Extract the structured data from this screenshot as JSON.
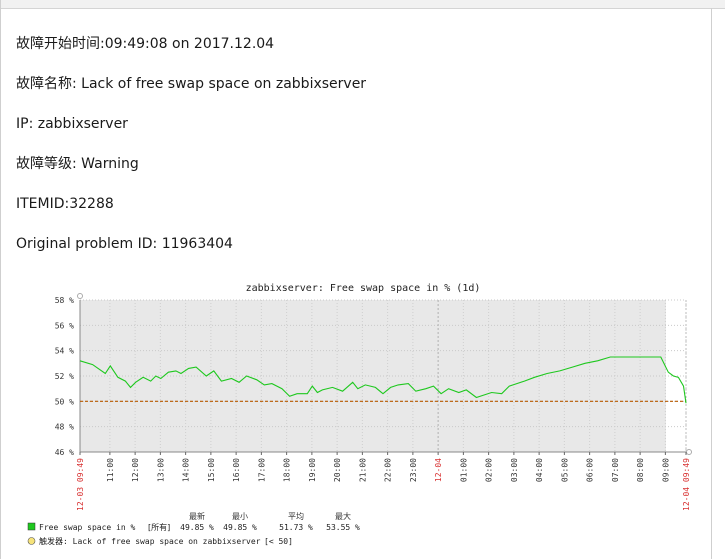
{
  "alert": {
    "start_time": "故障开始时间:09:49:08 on 2017.12.04",
    "name": "故障名称: Lack of free swap space on zabbixserver",
    "ip": "IP: zabbixserver",
    "severity": "故障等级: Warning",
    "itemid": "ITEMID:32288",
    "problem_id": "Original problem ID: 11963404"
  },
  "chart_data": {
    "type": "line",
    "title": "zabbixserver: Free swap space in % (1d)",
    "ylim": [
      46,
      58
    ],
    "y_ticks": [
      "58 %",
      "56 %",
      "54 %",
      "52 %",
      "50 %",
      "48 %",
      "46 %"
    ],
    "x_ticks": [
      "12-03 09:49",
      "11:00",
      "12:00",
      "13:00",
      "14:00",
      "15:00",
      "16:00",
      "17:00",
      "18:00",
      "19:00",
      "20:00",
      "21:00",
      "22:00",
      "23:00",
      "12-04",
      "01:00",
      "02:00",
      "03:00",
      "04:00",
      "05:00",
      "06:00",
      "07:00",
      "08:00",
      "09:00",
      "12-04 09:49"
    ],
    "red_ticks": [
      "12-03 09:49",
      "12-04",
      "12-04 09:49"
    ],
    "grid": true,
    "x": [
      0,
      0.5,
      1.0,
      1.2,
      1.5,
      1.8,
      2.0,
      2.2,
      2.5,
      2.8,
      3.0,
      3.2,
      3.5,
      3.8,
      4.0,
      4.3,
      4.6,
      5.0,
      5.3,
      5.6,
      6.0,
      6.3,
      6.6,
      7.0,
      7.3,
      7.6,
      8.0,
      8.3,
      8.6,
      9.0,
      9.2,
      9.4,
      9.6,
      10.0,
      10.4,
      10.8,
      11.0,
      11.3,
      11.7,
      12.0,
      12.3,
      12.6,
      13.0,
      13.3,
      13.7,
      14.0,
      14.3,
      14.6,
      15.0,
      15.3,
      15.7,
      16.0,
      16.3,
      16.7,
      17.0,
      17.3,
      17.6,
      18.0,
      18.5,
      19.0,
      19.5,
      20.0,
      20.5,
      21.0,
      21.5,
      22.0,
      22.5,
      23.0,
      23.3,
      23.5,
      23.7,
      23.9,
      24.0
    ],
    "series": [
      {
        "name": "Free swap space in %",
        "color": "#1ec81e",
        "values": [
          53.2,
          52.9,
          52.2,
          52.8,
          51.9,
          51.6,
          51.1,
          51.5,
          51.9,
          51.6,
          52.0,
          51.8,
          52.3,
          52.4,
          52.2,
          52.6,
          52.7,
          52.0,
          52.4,
          51.6,
          51.8,
          51.5,
          52.0,
          51.7,
          51.3,
          51.4,
          51.0,
          50.4,
          50.6,
          50.6,
          51.2,
          50.7,
          50.9,
          51.1,
          50.8,
          51.5,
          51.0,
          51.3,
          51.1,
          50.6,
          51.1,
          51.3,
          51.4,
          50.8,
          51.0,
          51.2,
          50.6,
          51.0,
          50.7,
          50.9,
          50.3,
          50.5,
          50.7,
          50.6,
          51.2,
          51.4,
          51.6,
          51.9,
          52.2,
          52.4,
          52.7,
          53.0,
          53.2,
          53.5,
          53.5,
          53.5,
          53.5,
          53.5,
          52.3,
          52.0,
          51.9,
          51.2,
          49.85
        ]
      }
    ],
    "trigger_level": 50,
    "legend": {
      "headers": [
        "最新",
        "最小",
        "平均",
        "最大"
      ],
      "item_name": "Free swap space in %",
      "item_group": "[所有]",
      "item_values": [
        "49.85 %",
        "49.85 %",
        "51.73 %",
        "53.55 %"
      ],
      "trigger_label": "触发器: Lack of free swap space on zabbixserver",
      "trigger_cond": "[< 50]",
      "trigger_color": "#b85a00"
    }
  }
}
